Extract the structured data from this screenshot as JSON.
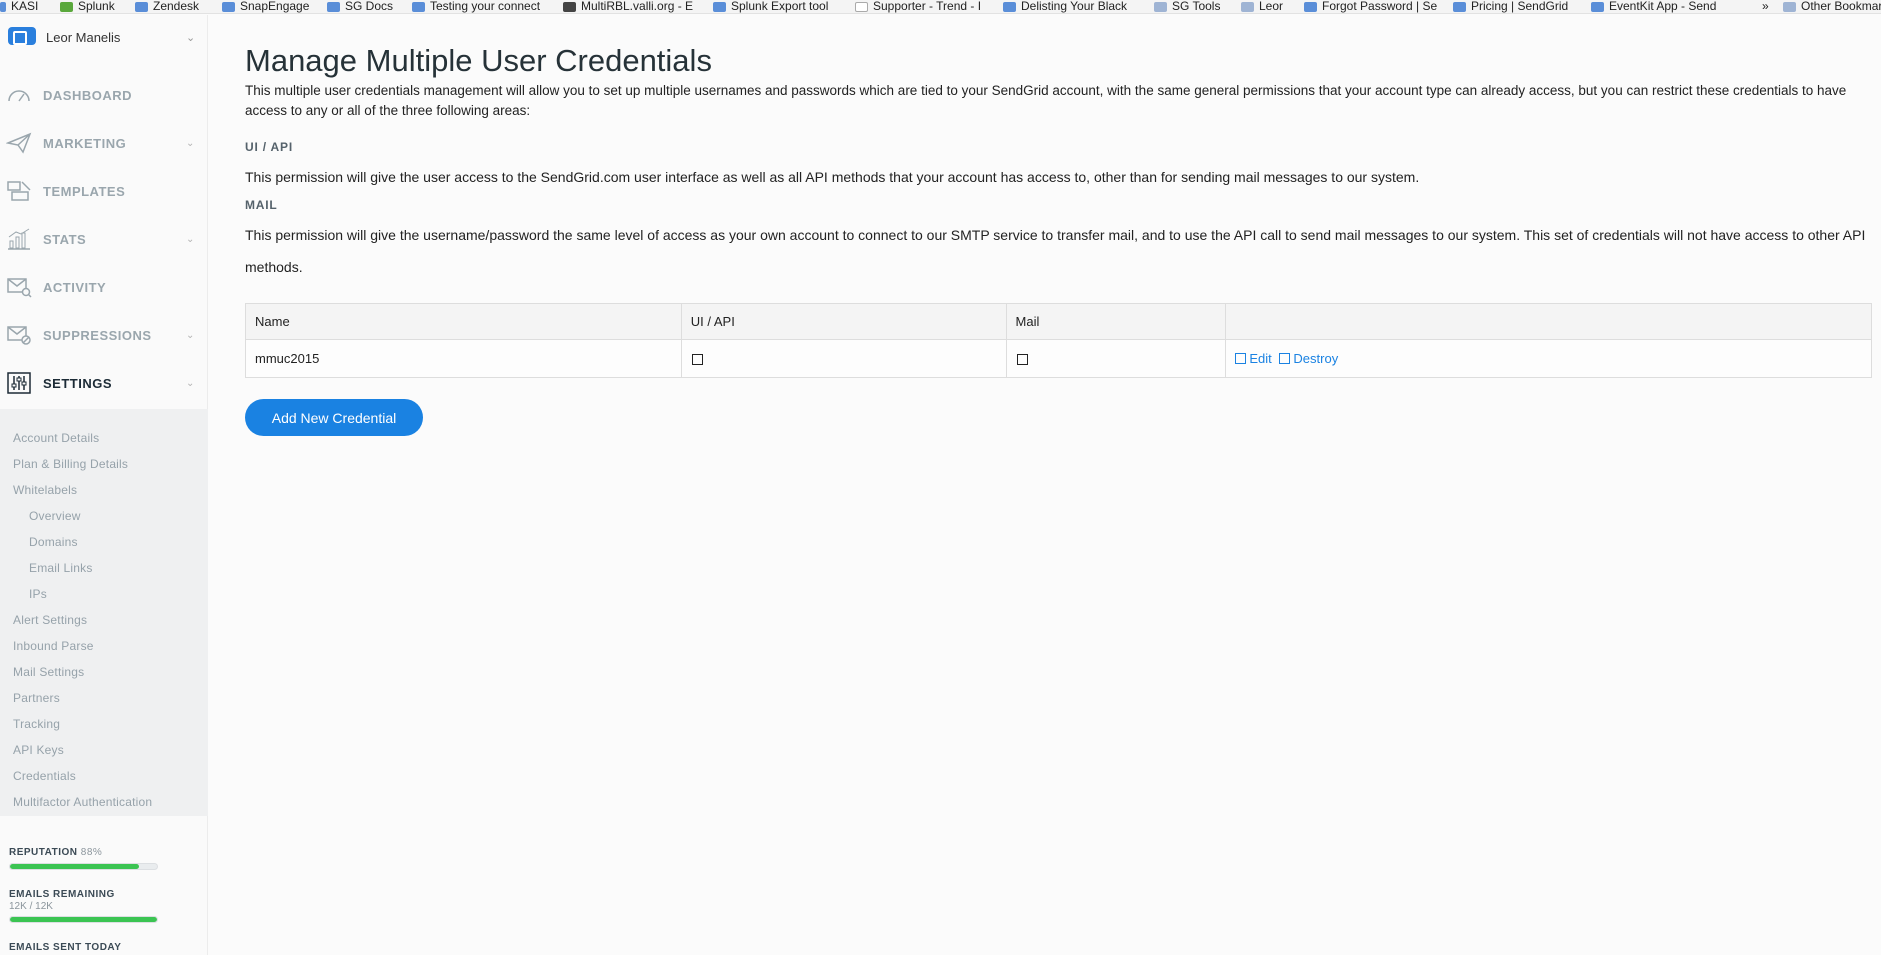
{
  "bookmarks": [
    {
      "label": "KASI",
      "icon": "bookmark-favicon"
    },
    {
      "label": "Splunk",
      "icon": "splunk-favicon"
    },
    {
      "label": "Zendesk",
      "icon": "zendesk-favicon"
    },
    {
      "label": "SnapEngage",
      "icon": "snapengage-favicon"
    },
    {
      "label": "SG Docs",
      "icon": "sendgrid-favicon"
    },
    {
      "label": "Testing your connect",
      "icon": "sendgrid-favicon"
    },
    {
      "label": "MultiRBL.valli.org - E",
      "icon": "document-favicon"
    },
    {
      "label": "Splunk Export tool",
      "icon": "sendgrid-favicon"
    },
    {
      "label": "Supporter - Trend - I",
      "icon": "page-favicon"
    },
    {
      "label": "Delisting Your Black",
      "icon": "delist-favicon"
    },
    {
      "label": "SG Tools",
      "icon": "folder-icon"
    },
    {
      "label": "Leor",
      "icon": "folder-icon"
    },
    {
      "label": "Forgot Password | Se",
      "icon": "sendgrid-favicon"
    },
    {
      "label": "Pricing | SendGrid",
      "icon": "sendgrid-favicon"
    },
    {
      "label": "EventKit App - Send",
      "icon": "sendgrid-favicon"
    },
    {
      "label": "»",
      "icon": ""
    },
    {
      "label": "Other Bookmarks",
      "icon": "folder-icon"
    }
  ],
  "user": {
    "name": "Leor Manelis"
  },
  "nav": [
    {
      "label": "DASHBOARD",
      "icon": "dashboard-gauge-icon",
      "has_chevron": false
    },
    {
      "label": "MARKETING",
      "icon": "paper-plane-icon",
      "has_chevron": true
    },
    {
      "label": "TEMPLATES",
      "icon": "templates-icon",
      "has_chevron": false
    },
    {
      "label": "STATS",
      "icon": "bar-chart-icon",
      "has_chevron": true
    },
    {
      "label": "ACTIVITY",
      "icon": "envelope-search-icon",
      "has_chevron": false
    },
    {
      "label": "SUPPRESSIONS",
      "icon": "envelope-blocked-icon",
      "has_chevron": true
    },
    {
      "label": "SETTINGS",
      "icon": "sliders-icon",
      "has_chevron": true,
      "active": true
    }
  ],
  "settings_menu": [
    {
      "label": "Account Details",
      "indent": 0
    },
    {
      "label": "Plan & Billing Details",
      "indent": 0
    },
    {
      "label": "Whitelabels",
      "indent": 0
    },
    {
      "label": "Overview",
      "indent": 1
    },
    {
      "label": "Domains",
      "indent": 1
    },
    {
      "label": "Email Links",
      "indent": 1
    },
    {
      "label": "IPs",
      "indent": 1
    },
    {
      "label": "Alert Settings",
      "indent": 0
    },
    {
      "label": "Inbound Parse",
      "indent": 0
    },
    {
      "label": "Mail Settings",
      "indent": 0
    },
    {
      "label": "Partners",
      "indent": 0
    },
    {
      "label": "Tracking",
      "indent": 0
    },
    {
      "label": "API Keys",
      "indent": 0
    },
    {
      "label": "Credentials",
      "indent": 0
    },
    {
      "label": "Multifactor Authentication",
      "indent": 0
    }
  ],
  "metrics": {
    "reputation_label": "REPUTATION",
    "reputation_value": "88%",
    "reputation_fraction": 0.88,
    "emails_remaining_label": "EMAILS REMAINING",
    "emails_remaining_value": "12K / 12K",
    "emails_remaining_fraction": 1.0,
    "emails_sent_label": "EMAILS SENT TODAY"
  },
  "page": {
    "title": "Manage Multiple User Credentials",
    "intro": "This multiple user credentials management will allow you to set up multiple usernames and passwords which are tied to your SendGrid account, with the same general permissions that your account type can already access, but you can restrict these credentials to have access to any or all of the three following areas:",
    "ui_api_heading": "UI / API",
    "ui_api_text": "This permission will give the user access to the SendGrid.com user interface as well as all API methods that your account has access to, other than for sending mail messages to our system.",
    "mail_heading": "MAIL",
    "mail_text": "This permission will give the username/password the same level of access as your own account to connect to our SMTP service to transfer mail, and to use the API call to send mail messages to our system. This set of credentials will not have access to other API methods."
  },
  "table": {
    "headers": [
      "Name",
      "UI / API",
      "Mail",
      ""
    ],
    "rows": [
      {
        "name": "mmuc2015",
        "ui_api": false,
        "mail": false,
        "edit_label": "Edit",
        "destroy_label": "Destroy"
      }
    ]
  },
  "add_button": "Add New Credential",
  "colors": {
    "accent": "#1a82e2",
    "progress": "#3bc452",
    "nav_active": "#1c2b36"
  }
}
